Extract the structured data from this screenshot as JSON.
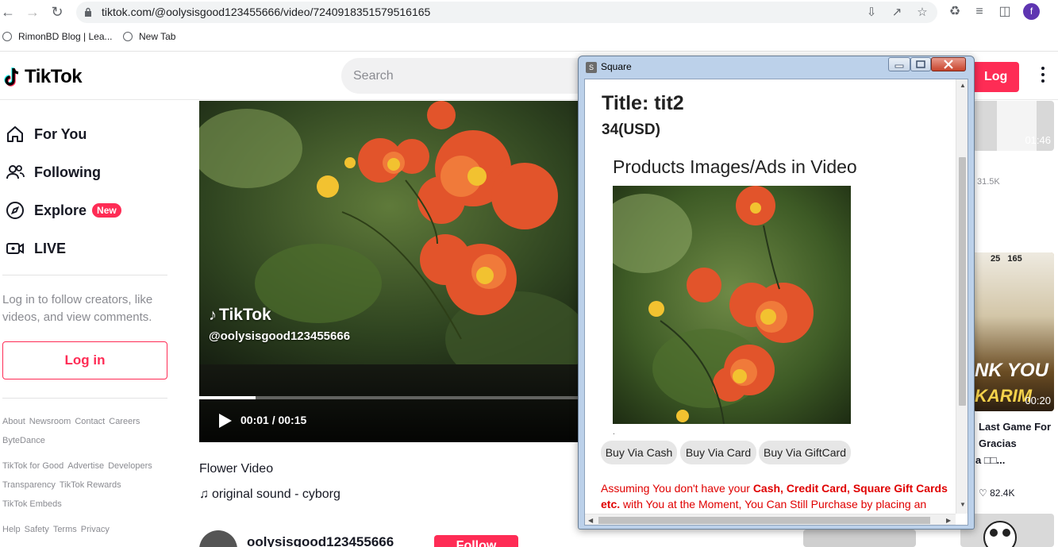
{
  "browser": {
    "url": "tiktok.com/@oolysisgood123455666/video/7240918351579516165",
    "profile_initial": "f",
    "bookmarks": [
      "RimonBD Blog | Lea...",
      "New Tab"
    ]
  },
  "tiktok": {
    "logo": "TikTok",
    "search_placeholder": "Search",
    "login_top": "Log in",
    "nav": [
      {
        "label": "For You",
        "icon": "home-icon"
      },
      {
        "label": "Following",
        "icon": "following-icon"
      },
      {
        "label": "Explore",
        "icon": "explore-icon",
        "badge": "New"
      },
      {
        "label": "LIVE",
        "icon": "live-icon"
      }
    ],
    "login_prompt": "Log in to follow creators, like videos, and view comments.",
    "login_button": "Log in",
    "footer": [
      [
        "About",
        "Newsroom",
        "Contact",
        "Careers"
      ],
      [
        "ByteDance"
      ],
      [
        "TikTok for Good",
        "Advertise",
        "Developers"
      ],
      [
        "Transparency",
        "TikTok Rewards"
      ],
      [
        "TikTok Embeds"
      ],
      [
        "Help",
        "Safety",
        "Terms",
        "Privacy"
      ]
    ],
    "video": {
      "watermark_logo": "TikTok",
      "watermark_user": "@oolysisgood123455666",
      "time": "00:01 / 00:15",
      "progress": 0.148,
      "title": "Flower Video",
      "sound": "original sound - cyborg",
      "author": "oolysisgood123455666",
      "follow": "Follow"
    },
    "related": [
      {
        "duration": "01:46",
        "views": "31.5K"
      },
      {
        "duration": "00:20",
        "title_line1": "Last Game For",
        "title_line2": "Gracias",
        "title_line3": "a \u0000...",
        "likes": "82.4K",
        "thumb_text": "NK YOU",
        "thumb_text2": "KARIM",
        "numbers": "25   165"
      }
    ]
  },
  "popup": {
    "window_title": "Square",
    "window_icon_letter": "S",
    "title": "Title: tit2",
    "price": "34(USD)",
    "section_heading": "Products Images/Ads in Video",
    "dot": ".",
    "buttons": [
      "Buy Via Cash",
      "Buy Via Card",
      "Buy Via GiftCard"
    ],
    "note_prefix": "Assuming You don't have your ",
    "note_bold": "Cash, Credit Card, Square Gift Cards etc.",
    "note_suffix": " with You at the Moment, You Can Still Purchase by placing an"
  },
  "colors": {
    "brand": "#fe2c55",
    "note_red": "#e00000"
  }
}
